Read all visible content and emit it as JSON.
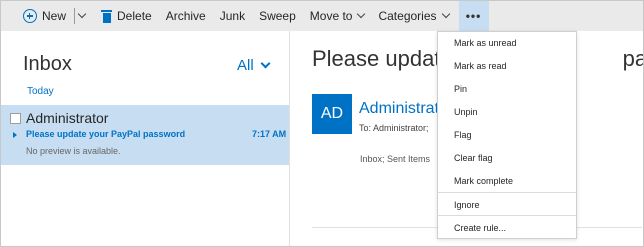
{
  "toolbar": {
    "new_label": "New",
    "delete_label": "Delete",
    "archive_label": "Archive",
    "junk_label": "Junk",
    "sweep_label": "Sweep",
    "move_to_label": "Move to",
    "categories_label": "Categories",
    "more_label": "•••"
  },
  "inbox": {
    "title": "Inbox",
    "filter": "All",
    "group": "Today",
    "message": {
      "sender": "Administrator",
      "subject": "Please update your PayPal password",
      "time": "7:17 AM",
      "preview": "No preview is available."
    }
  },
  "reading": {
    "subject_visible": "Please update",
    "subject_tail": "password",
    "avatar_initials": "AD",
    "from": "Administrat",
    "to": "To: Administrator;",
    "folders": "Inbox; Sent Items"
  },
  "menu": {
    "items": [
      "Mark as unread",
      "Mark as read",
      "Pin",
      "Unpin",
      "Flag",
      "Clear flag",
      "Mark complete"
    ],
    "items_after_sep": [
      "Ignore"
    ],
    "items_last": [
      "Create rule..."
    ]
  },
  "colors": {
    "accent": "#0072c6",
    "selection": "#c7ddf2",
    "toolbar_bg": "#eaeaea"
  }
}
